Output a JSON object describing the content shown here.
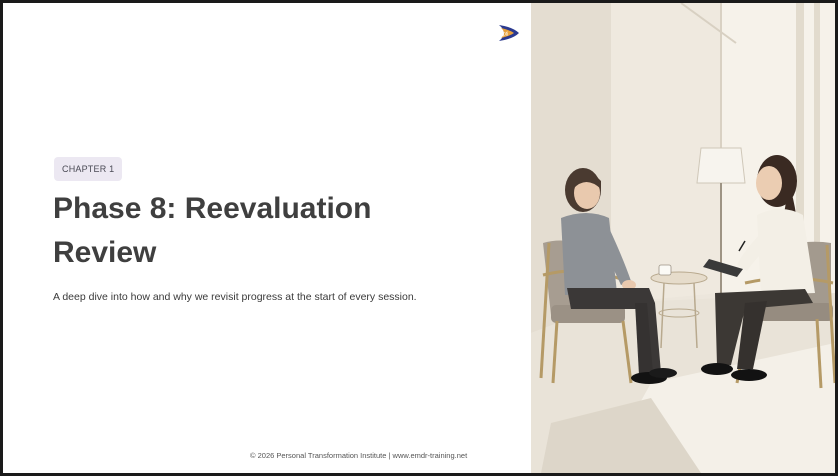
{
  "slide": {
    "logo_icon": "pti-logo-icon",
    "chapter_badge": "CHAPTER 1",
    "title_line1": "Phase 8: Reevaluation",
    "title_line2": "Review",
    "subtitle": "A deep dive into how and why we revisit progress at the start of every session.",
    "footer": "© 2026 Personal Transformation Institute | www.emdr-training.net"
  },
  "colors": {
    "title": "#3f3f3f",
    "badge_bg": "#ece8f2",
    "logo_blue": "#2b3a8f",
    "logo_orange": "#e8a13a"
  }
}
